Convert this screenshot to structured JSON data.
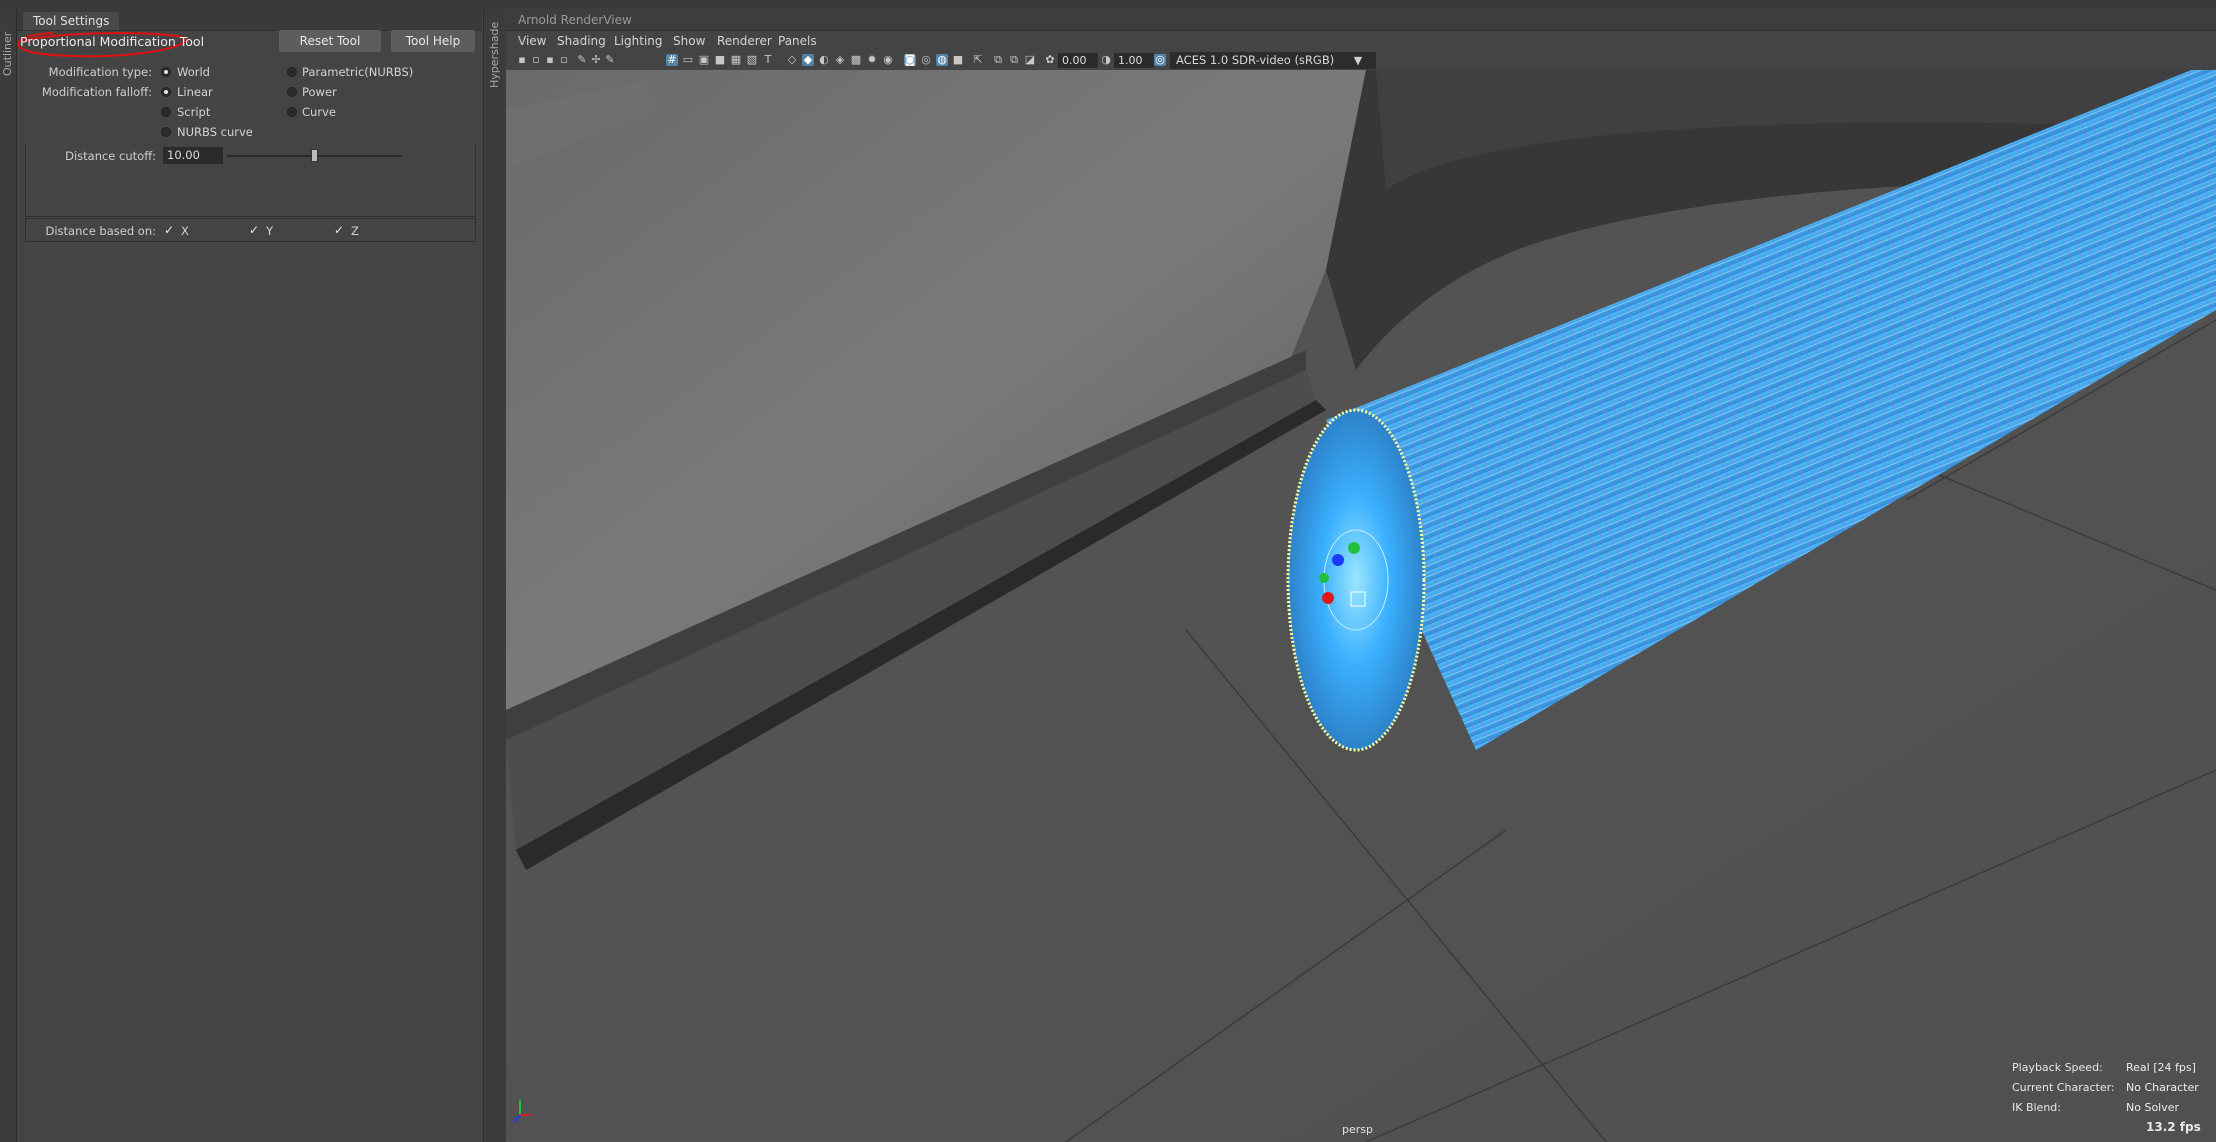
{
  "left_rail": {
    "outliner_label": "Outliner"
  },
  "tool_settings": {
    "tab_label": "Tool Settings",
    "tool_name": "Proportional Modification Tool",
    "reset_button": "Reset Tool",
    "help_button": "Tool Help",
    "modification_type": {
      "label": "Modification type:",
      "options": [
        {
          "label": "World",
          "selected": true
        },
        {
          "label": "Parametric(NURBS)",
          "selected": false
        }
      ]
    },
    "modification_falloff": {
      "label": "Modification falloff:",
      "options": [
        {
          "label": "Linear",
          "selected": true
        },
        {
          "label": "Power",
          "selected": false
        },
        {
          "label": "Script",
          "selected": false
        },
        {
          "label": "Curve",
          "selected": false
        },
        {
          "label": "NURBS curve",
          "selected": false
        }
      ]
    },
    "distance_cutoff": {
      "label": "Distance cutoff:",
      "value": "10.00",
      "slider_fraction": 0.5
    },
    "distance_based_on": {
      "label": "Distance based on:",
      "axes": [
        {
          "label": "X",
          "checked": true
        },
        {
          "label": "Y",
          "checked": true
        },
        {
          "label": "Z",
          "checked": true
        }
      ]
    }
  },
  "splitter": {
    "hypershade_label": "Hypershade"
  },
  "viewport": {
    "panel_title": "Arnold RenderView",
    "menu": [
      "View",
      "Shading",
      "Lighting",
      "Show",
      "Renderer",
      "Panels"
    ],
    "toolbar": {
      "exposure": "0.00",
      "gamma": "1.00",
      "color_space": "ACES 1.0 SDR-video (sRGB)"
    },
    "camera_label": "persp",
    "hud": [
      {
        "key": "Playback Speed:",
        "value": "Real [24 fps]"
      },
      {
        "key": "Current Character:",
        "value": "No Character"
      },
      {
        "key": "IK Blend:",
        "value": "No Solver"
      }
    ],
    "fps": "13.2 fps"
  },
  "colors": {
    "selection_highlight": "#3ab0ff",
    "wire_purple": "#8a7aff",
    "vertex_yellow": "#ffffa0",
    "annotation_red": "#e01010"
  }
}
